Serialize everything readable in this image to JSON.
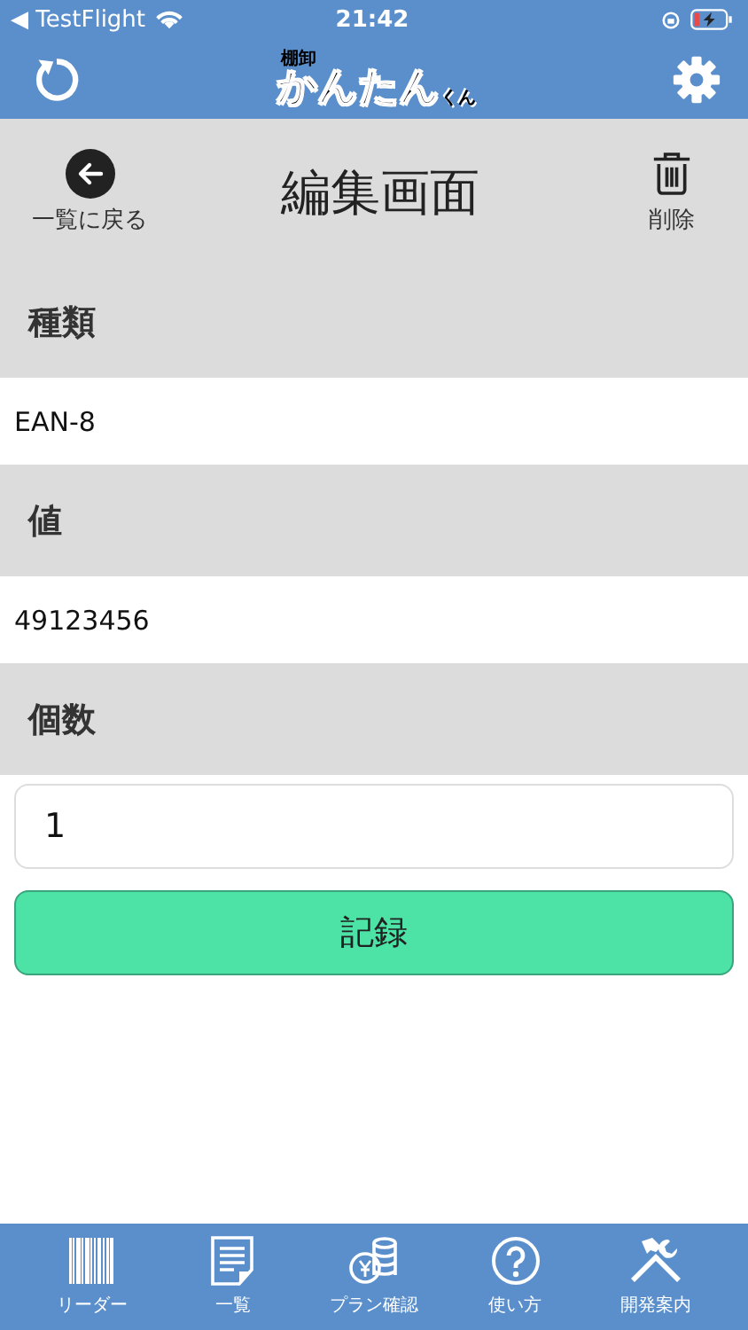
{
  "status_bar": {
    "back_app": "◀ TestFlight",
    "time": "21:42"
  },
  "header": {
    "logo_top": "棚卸",
    "logo_main": "かんたん",
    "logo_suffix": "くん"
  },
  "toolbar": {
    "back_label": "一覧に戻る",
    "title": "編集画面",
    "delete_label": "削除"
  },
  "fields": [
    {
      "kind": "readonly",
      "label": "種類",
      "value": "EAN-8"
    },
    {
      "kind": "readonly",
      "label": "値",
      "value": "49123456"
    },
    {
      "kind": "input",
      "label": "個数",
      "value": "1"
    }
  ],
  "submit_button": "記録",
  "tab_bar": [
    {
      "label": "リーダー"
    },
    {
      "label": "一覧"
    },
    {
      "label": "プラン確認"
    },
    {
      "label": "使い方"
    },
    {
      "label": "開発案内"
    }
  ]
}
